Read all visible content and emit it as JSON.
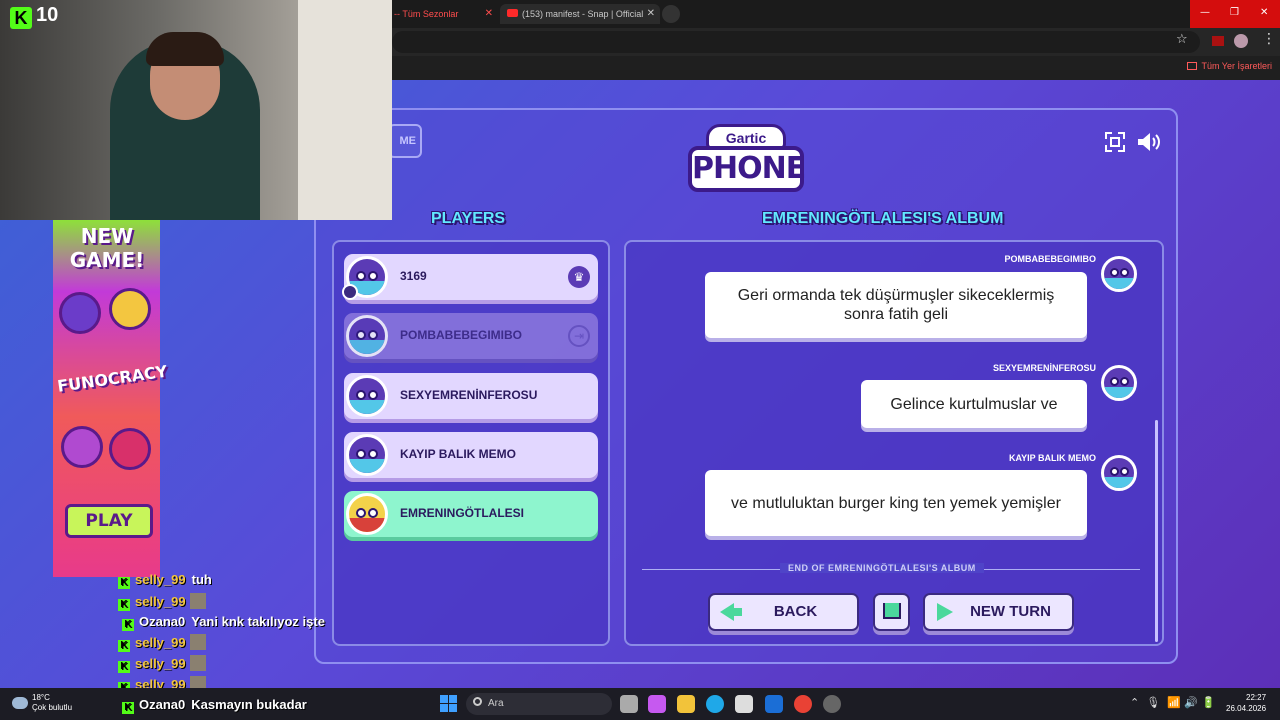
{
  "browser": {
    "tab1_title": "-- Tüm Sezonlar",
    "tab2_title": "(153) manifest - Snap | Official",
    "bookmarks_all": "Tüm Yer İşaretleri"
  },
  "stream": {
    "kick_viewers": "10"
  },
  "game": {
    "home_label": "ME",
    "logo_top": "Gartic",
    "logo_main": "PHONE",
    "players_title": "PLAYERS",
    "album_title": "EMRENINGÖTLALESI'S ALBUM",
    "players": [
      {
        "name": "3169",
        "badge": "crown-icon",
        "state": "normal"
      },
      {
        "name": "POMBABEBEGIMIBO",
        "badge": "kick-icon",
        "state": "dim"
      },
      {
        "name": "SEXYEMRENİNFEROSU",
        "state": "normal"
      },
      {
        "name": "KAYIP BALIK MEMO",
        "state": "normal"
      },
      {
        "name": "EMRENINGÖTLALESI",
        "state": "me"
      }
    ],
    "album": [
      {
        "author": "POMBABEBEGIMIBO",
        "text": "Geri ormanda tek düşürmuşler sikeceklermiş sonra fatih geli"
      },
      {
        "author": "SEXYEMRENİNFEROSU",
        "text": "Gelince kurtulmuslar ve"
      },
      {
        "author": "KAYIP BALIK MEMO",
        "text": "ve mutluluktan burger king ten yemek yemişler"
      }
    ],
    "end_text": "END OF EMRENINGÖTLALESI'S ALBUM",
    "back_label": "BACK",
    "new_turn_label": "NEW TURN"
  },
  "ad": {
    "title": "NEW GAME!",
    "brand": "FUNOCRACY",
    "play_label": "PLAY"
  },
  "chat": [
    {
      "user": "selly_99",
      "msg": "tuh",
      "emote": false
    },
    {
      "user": "selly_99",
      "msg": "",
      "emote": true
    },
    {
      "user": "Ozana0",
      "msg": "Yani knk takılıyoz işte",
      "emote": false
    },
    {
      "user": "selly_99",
      "msg": "",
      "emote": true
    },
    {
      "user": "selly_99",
      "msg": "",
      "emote": true
    },
    {
      "user": "selly_99",
      "msg": "",
      "emote": true
    },
    {
      "user": "Ozana0",
      "msg": "Kasmayın bukadar",
      "emote": false
    }
  ],
  "taskbar": {
    "temp": "18°C",
    "weather": "Çok bulutlu",
    "search_placeholder": "Ara",
    "time": "22:27",
    "date": "26.04.2026"
  }
}
